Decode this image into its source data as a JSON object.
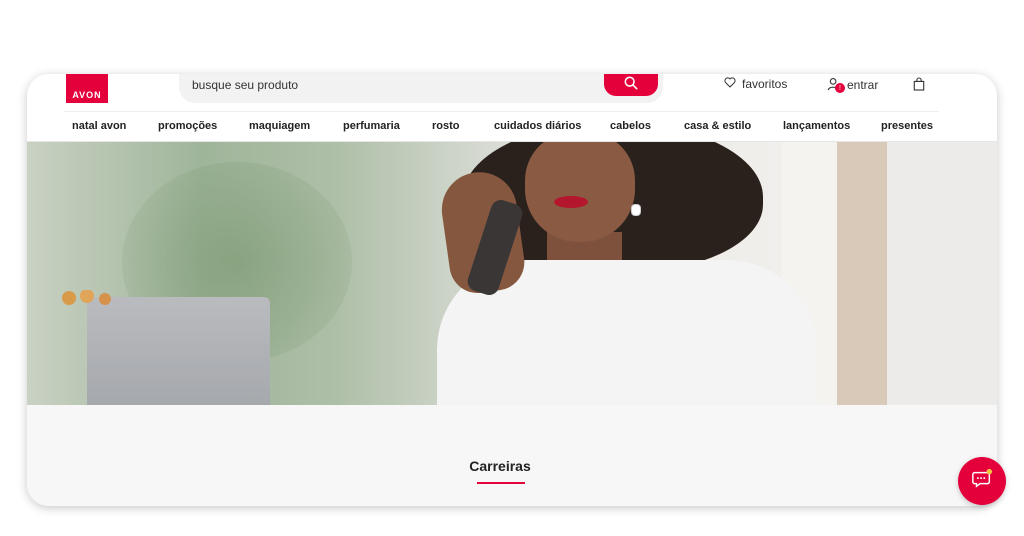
{
  "brand": {
    "logo_text": "AVON",
    "accent_color": "#e3003b"
  },
  "search": {
    "placeholder": "busque seu produto",
    "button_icon": "search-icon"
  },
  "utility": {
    "favorites_label": "favoritos",
    "favorites_icon": "heart-icon",
    "login_label": "entrar",
    "login_icon": "user-icon",
    "login_badge": "!",
    "cart_icon": "shopping-bag-icon"
  },
  "nav": {
    "items": [
      {
        "label": "natal avon"
      },
      {
        "label": "promoções"
      },
      {
        "label": "maquiagem"
      },
      {
        "label": "perfumaria"
      },
      {
        "label": "rosto"
      },
      {
        "label": "cuidados diários"
      },
      {
        "label": "cabelos"
      },
      {
        "label": "casa & estilo"
      },
      {
        "label": "lançamentos"
      },
      {
        "label": "presentes"
      }
    ]
  },
  "section": {
    "title": "Carreiras"
  },
  "chat": {
    "icon": "chat-bubble-icon"
  }
}
